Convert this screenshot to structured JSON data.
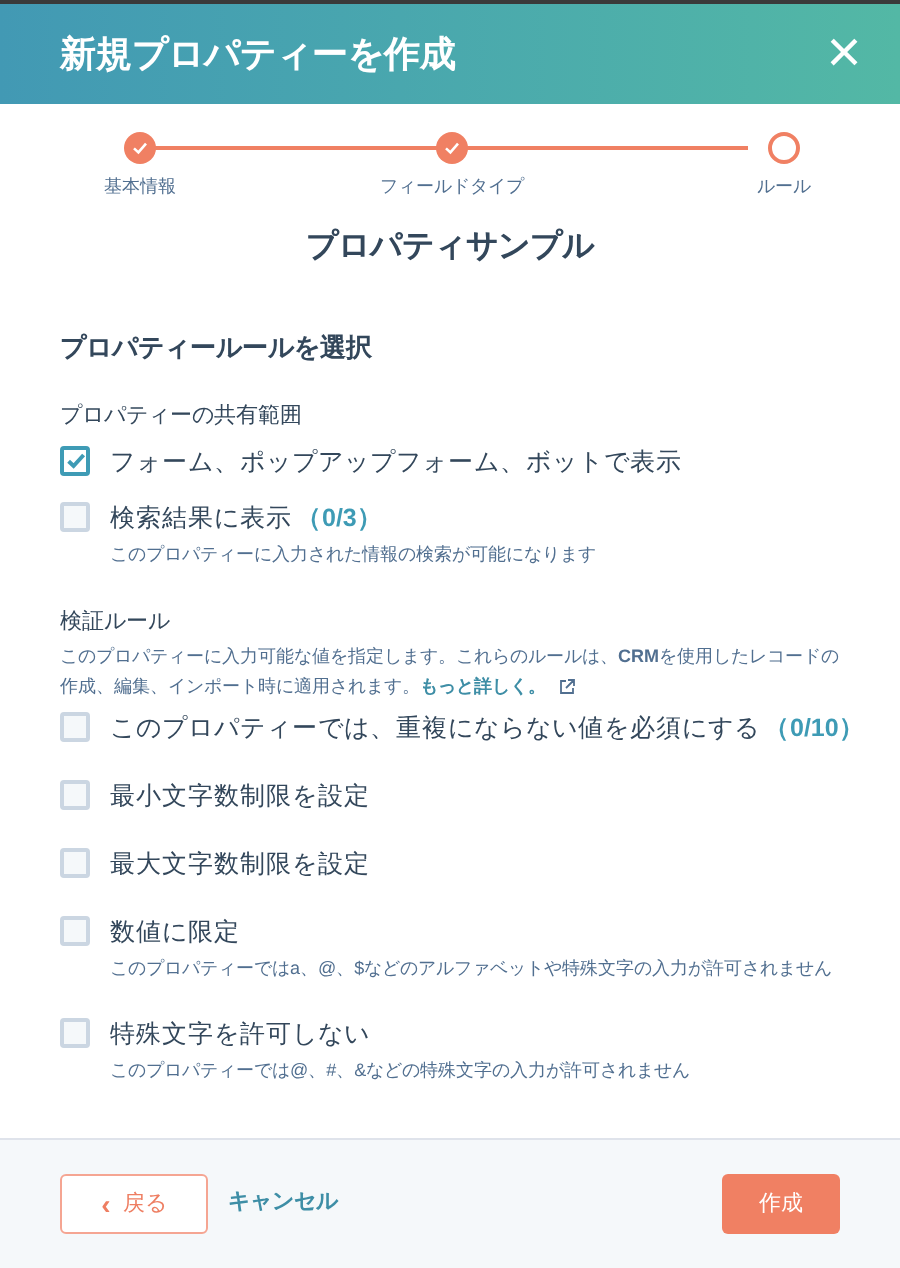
{
  "dialog": {
    "title": "新規プロパティーを作成",
    "close": "×"
  },
  "steps": [
    {
      "label": "基本情報",
      "done": true
    },
    {
      "label": "フィールドタイプ",
      "done": true
    },
    {
      "label": "ルール",
      "done": false
    }
  ],
  "property_name": "プロパティサンプル",
  "section_title": "プロパティールールを選択",
  "sharing": {
    "label": "プロパティーの共有範囲",
    "options": [
      {
        "label": "フォーム、ポップアップフォーム、ボットで表示",
        "checked": true
      },
      {
        "label": "検索結果に表示",
        "count": "（0/3）",
        "help": "このプロパティーに入力された情報の検索が可能になります",
        "checked": false
      }
    ]
  },
  "validation": {
    "label": "検証ルール",
    "description": "このプロパティーに入力可能な値を指定します。これらのルールは、**CRM**を使用したレコードの作成、編集、インポート時に適用されます。",
    "link": "もっと詳しく。",
    "options": [
      {
        "label": "このプロパティーでは、重複にならない値を必須にする",
        "count": "（0/10）",
        "checked": false
      },
      {
        "label": "最小文字数制限を設定",
        "checked": false
      },
      {
        "label": "最大文字数制限を設定",
        "checked": false
      },
      {
        "label": "数値に限定",
        "help": "このプロパティーではa、@、$などのアルファベットや特殊文字の入力が許可されません",
        "checked": false
      },
      {
        "label": "特殊文字を許可しない",
        "help": "このプロパティーでは@、#、&などの特殊文字の入力が許可されません",
        "checked": false
      }
    ]
  },
  "footer": {
    "back": "戻る",
    "back_icon": "‹",
    "cancel": "キャンセル",
    "create": "作成"
  }
}
